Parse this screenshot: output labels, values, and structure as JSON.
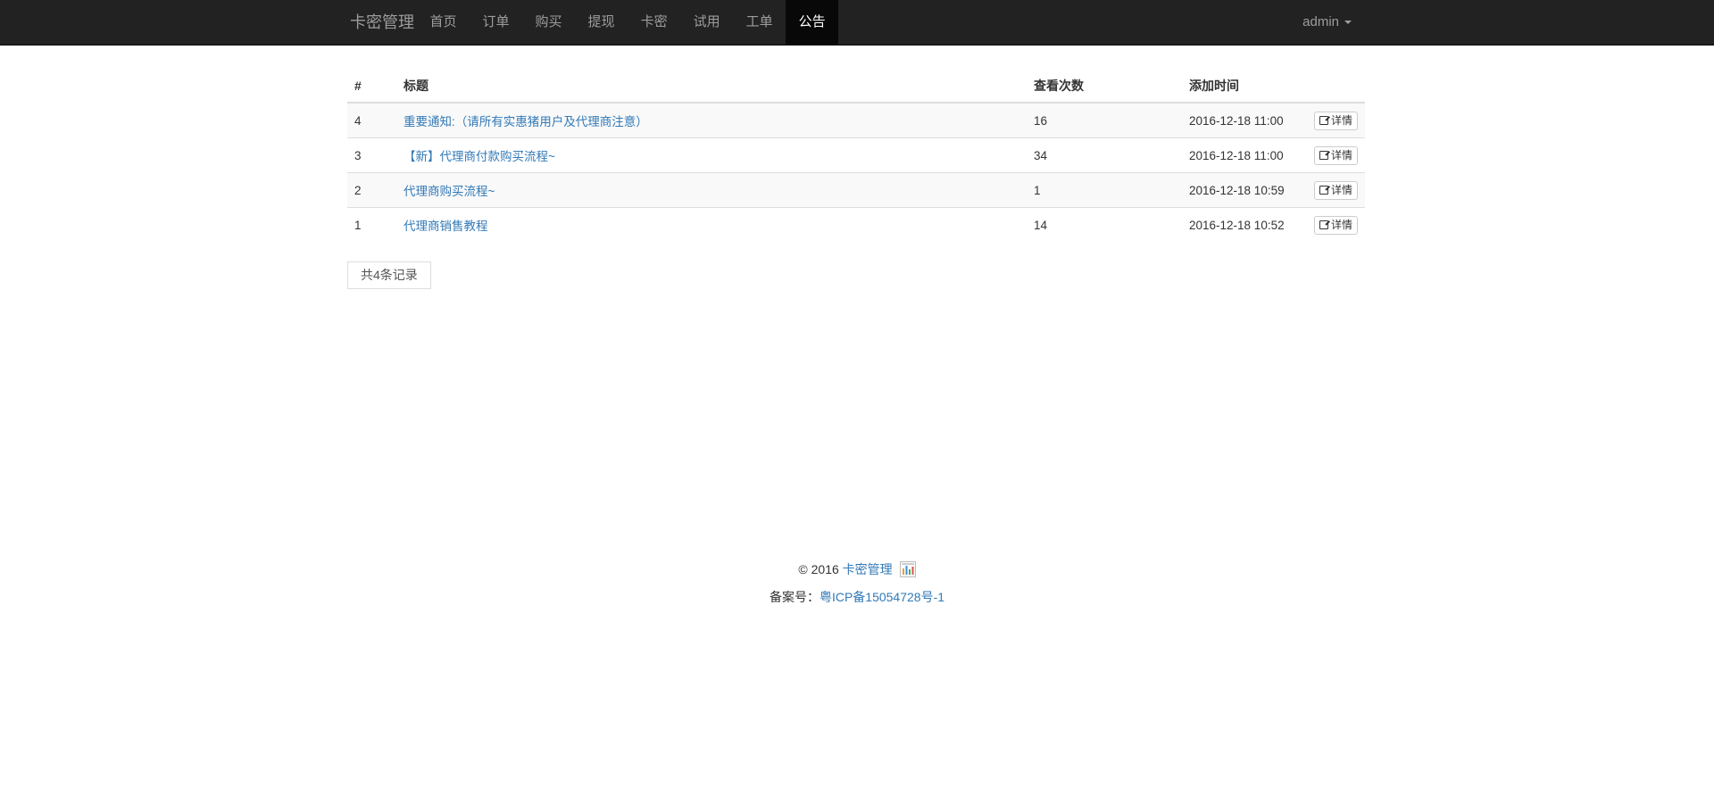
{
  "nav": {
    "brand": "卡密管理",
    "items": [
      {
        "label": "首页"
      },
      {
        "label": "订单"
      },
      {
        "label": "购买"
      },
      {
        "label": "提现"
      },
      {
        "label": "卡密"
      },
      {
        "label": "试用"
      },
      {
        "label": "工单"
      },
      {
        "label": "公告"
      }
    ],
    "user": "admin"
  },
  "table": {
    "headers": [
      "#",
      "标题",
      "查看次数",
      "添加时间"
    ],
    "rows": [
      {
        "id": "4",
        "title": "重要通知:（请所有实惠猪用户及代理商注意）",
        "views": "16",
        "time": "2016-12-18 11:00",
        "action": "详情"
      },
      {
        "id": "3",
        "title": "【新】代理商付款购买流程~",
        "views": "34",
        "time": "2016-12-18 11:00",
        "action": "详情"
      },
      {
        "id": "2",
        "title": "代理商购买流程~",
        "views": "1",
        "time": "2016-12-18 10:59",
        "action": "详情"
      },
      {
        "id": "1",
        "title": "代理商销售教程",
        "views": "14",
        "time": "2016-12-18 10:52",
        "action": "详情"
      }
    ]
  },
  "pager": {
    "total_label": "共4条记录"
  },
  "footer": {
    "copyright": "© 2016",
    "site_link": "卡密管理",
    "icp_label": "备案号：",
    "icp_link": "粤ICP备15054728号-1"
  },
  "colors": {
    "navbar_bg": "#222222",
    "navbar_active": "#080808",
    "link": "#337ab7"
  }
}
